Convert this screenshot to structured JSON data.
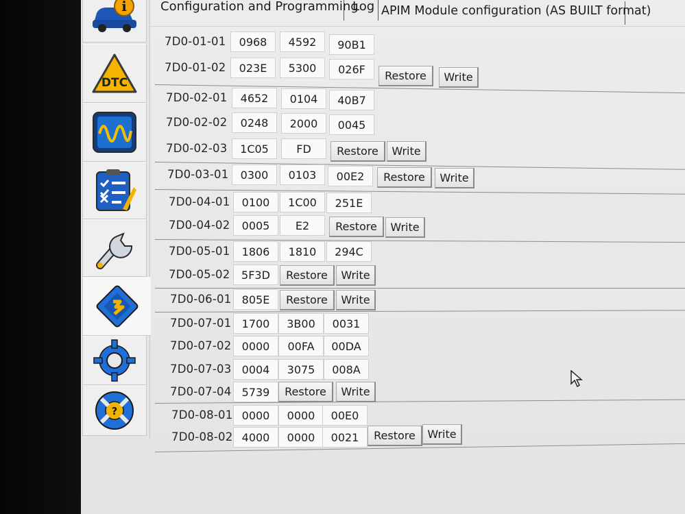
{
  "tabs": {
    "configuration": "Configuration and Programming",
    "log": "Log",
    "module": "APIM Module configuration (AS BUILT format)"
  },
  "sidebar": {
    "items": [
      {
        "icon": "car-info-icon"
      },
      {
        "icon": "dtc-warning-icon"
      },
      {
        "icon": "oscilloscope-icon"
      },
      {
        "icon": "checklist-icon"
      },
      {
        "icon": "wrench-icon"
      },
      {
        "icon": "module-chip-icon"
      },
      {
        "icon": "gear-icon"
      },
      {
        "icon": "help-lifebuoy-icon"
      }
    ]
  },
  "labels": {
    "restore": "Restore",
    "write": "Write"
  },
  "rows": [
    {
      "addr": "7D0-01-01",
      "values": [
        "0968",
        "4592",
        "90B1"
      ]
    },
    {
      "addr": "7D0-01-02",
      "values": [
        "023E",
        "5300",
        "026F"
      ]
    },
    {
      "addr": "7D0-02-01",
      "values": [
        "4652",
        "0104",
        "40B7"
      ]
    },
    {
      "addr": "7D0-02-02",
      "values": [
        "0248",
        "2000",
        "0045"
      ]
    },
    {
      "addr": "7D0-02-03",
      "values": [
        "1C05",
        "FD"
      ]
    },
    {
      "addr": "7D0-03-01",
      "values": [
        "0300",
        "0103",
        "00E2"
      ]
    },
    {
      "addr": "7D0-04-01",
      "values": [
        "0100",
        "1C00",
        "251E"
      ]
    },
    {
      "addr": "7D0-04-02",
      "values": [
        "0005",
        "E2"
      ]
    },
    {
      "addr": "7D0-05-01",
      "values": [
        "1806",
        "1810",
        "294C"
      ]
    },
    {
      "addr": "7D0-05-02",
      "values": [
        "5F3D"
      ]
    },
    {
      "addr": "7D0-06-01",
      "values": [
        "805E"
      ]
    },
    {
      "addr": "7D0-07-01",
      "values": [
        "1700",
        "3B00",
        "0031"
      ]
    },
    {
      "addr": "7D0-07-02",
      "values": [
        "0000",
        "00FA",
        "00DA"
      ]
    },
    {
      "addr": "7D0-07-03",
      "values": [
        "0004",
        "3075",
        "008A"
      ]
    },
    {
      "addr": "7D0-07-04",
      "values": [
        "5739"
      ]
    },
    {
      "addr": "7D0-08-01",
      "values": [
        "0000",
        "0000",
        "00E0"
      ]
    },
    {
      "addr": "7D0-08-02",
      "values": [
        "4000",
        "0000",
        "0021"
      ]
    }
  ]
}
